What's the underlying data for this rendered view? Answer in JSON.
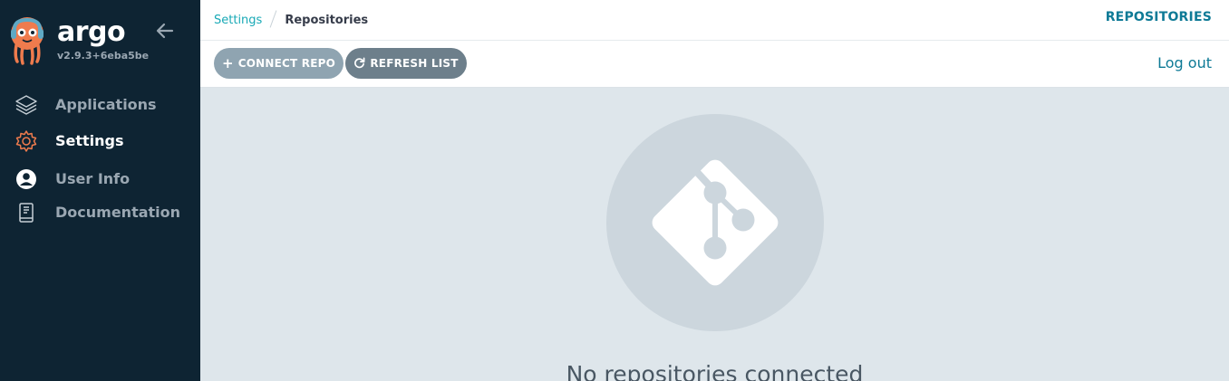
{
  "brand": {
    "name": "argo",
    "version": "v2.9.3+6eba5be",
    "logo_icon": "argo-octopus-logo"
  },
  "sidebar": {
    "collapse_icon": "arrow-left-icon",
    "items": [
      {
        "label": "Applications",
        "icon": "layers-icon",
        "active": false
      },
      {
        "label": "Settings",
        "icon": "gear-icon",
        "active": true
      },
      {
        "label": "User Info",
        "icon": "user-circle-icon",
        "active": false
      },
      {
        "label": "Documentation",
        "icon": "book-icon",
        "active": false
      }
    ]
  },
  "topbar": {
    "breadcrumb": {
      "parent": "Settings",
      "current": "Repositories"
    },
    "page_heading": "REPOSITORIES"
  },
  "toolbar": {
    "connect_label": "CONNECT REPO",
    "refresh_label": "REFRESH LIST",
    "logout_label": "Log out"
  },
  "main": {
    "empty_icon": "git-icon",
    "empty_message": "No repositories connected"
  },
  "colors": {
    "sidebar_bg": "#0e2433",
    "accent": "#0e7a96",
    "breadcrumb_link": "#18a9b6",
    "content_bg": "#dee6eb",
    "logo_orange": "#ef7b4d"
  }
}
